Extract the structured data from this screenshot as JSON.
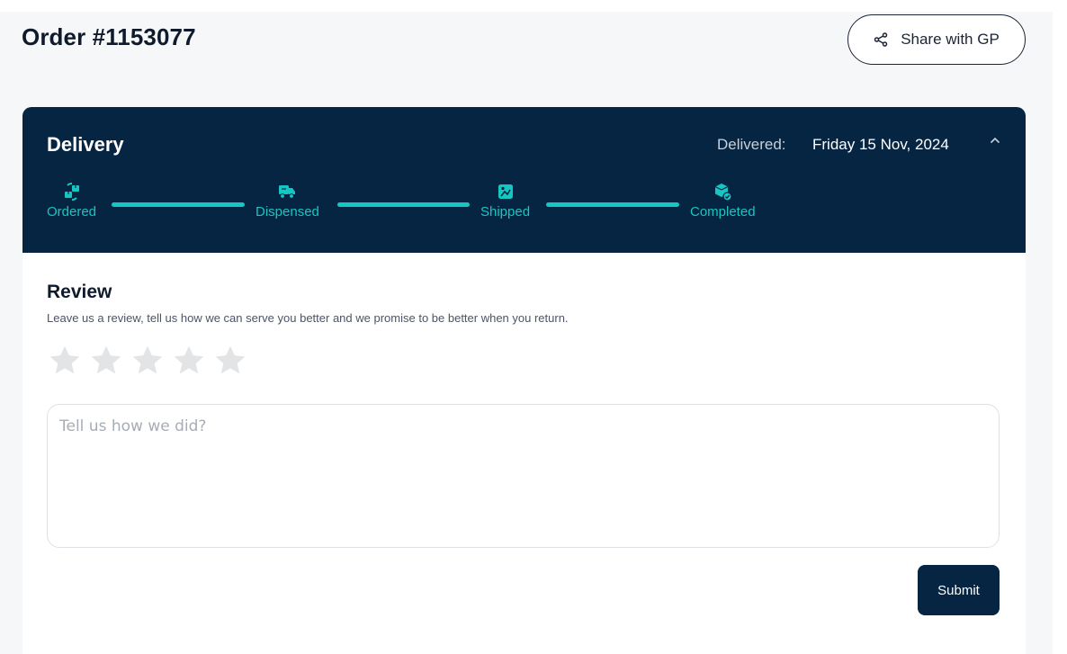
{
  "header": {
    "title": "Order #1153077",
    "share_label": "Share with GP"
  },
  "delivery": {
    "title": "Delivery",
    "delivered_label": "Delivered:",
    "delivered_date": "Friday 15 Nov, 2024",
    "steps": [
      {
        "label": "Ordered",
        "icon": "boxes-cycle-icon",
        "completed": true
      },
      {
        "label": "Dispensed",
        "icon": "delivery-truck-icon",
        "completed": true
      },
      {
        "label": "Shipped",
        "icon": "shipped-box-icon",
        "completed": true
      },
      {
        "label": "Completed",
        "icon": "box-check-icon",
        "completed": true
      }
    ]
  },
  "review": {
    "title": "Review",
    "subtitle": "Leave us a review, tell us how we can serve you better and we promise to be better when you return.",
    "rating": 0,
    "max_rating": 5,
    "textarea_placeholder": "Tell us how we did?",
    "textarea_value": "",
    "submit_label": "Submit"
  },
  "colors": {
    "accent": "#16c6c2",
    "navy": "#052542",
    "star_empty": "#e3e4e6"
  }
}
